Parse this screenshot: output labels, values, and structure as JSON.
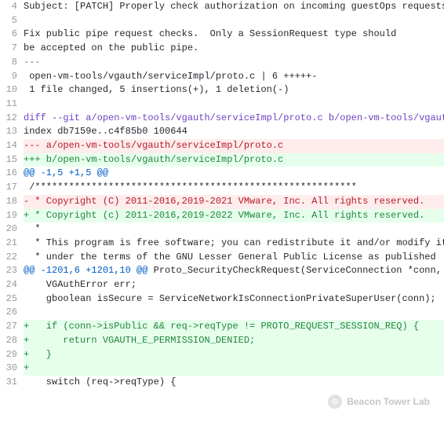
{
  "watermark": {
    "icon_label": "⊙",
    "text": "Beacon Tower Lab"
  },
  "lines": [
    {
      "n": 4,
      "bg": "",
      "tokens": [
        {
          "c": "fg-black",
          "t": "Subject: [PATCH] Properly check authorization on incoming guestOps requests"
        }
      ]
    },
    {
      "n": 5,
      "bg": "",
      "tokens": []
    },
    {
      "n": 6,
      "bg": "",
      "tokens": [
        {
          "c": "fg-black",
          "t": "Fix public pipe request checks.  Only a SessionRequest type should"
        }
      ]
    },
    {
      "n": 7,
      "bg": "",
      "tokens": [
        {
          "c": "fg-black",
          "t": "be accepted on the public pipe."
        }
      ]
    },
    {
      "n": 8,
      "bg": "",
      "tokens": [
        {
          "c": "fg-comment",
          "t": "---"
        }
      ]
    },
    {
      "n": 9,
      "bg": "",
      "tokens": [
        {
          "c": "fg-black",
          "t": " open-vm-tools/vgauth/serviceImpl/proto.c | 6 +++++-"
        }
      ]
    },
    {
      "n": 10,
      "bg": "",
      "tokens": [
        {
          "c": "fg-black",
          "t": " 1 file changed, 5 insertions(+), 1 deletion(-)"
        }
      ]
    },
    {
      "n": 11,
      "bg": "",
      "tokens": []
    },
    {
      "n": 12,
      "bg": "",
      "tokens": [
        {
          "c": "fg-diffhdr",
          "t": "diff --git a/open-vm-tools/vgauth/serviceImpl/proto.c b/open-vm-tools/vgauth/s"
        }
      ]
    },
    {
      "n": 13,
      "bg": "",
      "tokens": [
        {
          "c": "fg-black",
          "t": "index db7159e..c4f85b0 100644"
        }
      ]
    },
    {
      "n": 14,
      "bg": "bg-del",
      "tokens": [
        {
          "c": "fg-del",
          "t": "--- a/open-vm-tools/vgauth/serviceImpl/proto.c"
        }
      ]
    },
    {
      "n": 15,
      "bg": "bg-add",
      "tokens": [
        {
          "c": "fg-add",
          "t": "+++ b/open-vm-tools/vgauth/serviceImpl/proto.c"
        }
      ]
    },
    {
      "n": 16,
      "bg": "",
      "tokens": [
        {
          "c": "fg-hunk",
          "t": "@@ -1,5 +1,5 @@"
        }
      ]
    },
    {
      "n": 17,
      "bg": "",
      "tokens": [
        {
          "c": "fg-black",
          "t": " /*********************************************************"
        }
      ]
    },
    {
      "n": 18,
      "bg": "bg-del",
      "tokens": [
        {
          "c": "fg-del",
          "t": "- * Copyright (C) 2011-2016,2019-2021 VMware, Inc. All rights reserved."
        }
      ]
    },
    {
      "n": 19,
      "bg": "bg-add",
      "tokens": [
        {
          "c": "fg-add",
          "t": "+ * Copyright (c) 2011-2016,2019-2022 VMware, Inc. All rights reserved."
        }
      ]
    },
    {
      "n": 20,
      "bg": "",
      "tokens": [
        {
          "c": "fg-black",
          "t": "  *"
        }
      ]
    },
    {
      "n": 21,
      "bg": "",
      "tokens": [
        {
          "c": "fg-black",
          "t": "  * This program is free software; you can redistribute it and/or modify it"
        }
      ]
    },
    {
      "n": 22,
      "bg": "",
      "tokens": [
        {
          "c": "fg-black",
          "t": "  * under the terms of the GNU Lesser General Public License as published"
        }
      ]
    },
    {
      "n": 23,
      "bg": "",
      "tokens": [
        {
          "c": "fg-hunk",
          "t": "@@ -1201,6 +1201,10 @@"
        },
        {
          "c": "fg-black",
          "t": " Proto_SecurityCheckRequest(ServiceConnection *conn,"
        }
      ]
    },
    {
      "n": 24,
      "bg": "",
      "tokens": [
        {
          "c": "fg-black",
          "t": "    VGAuthError err;"
        }
      ]
    },
    {
      "n": 25,
      "bg": "",
      "tokens": [
        {
          "c": "fg-black",
          "t": "    gboolean isSecure = ServiceNetworkIsConnectionPrivateSuperUser(conn);"
        }
      ]
    },
    {
      "n": 26,
      "bg": "",
      "tokens": []
    },
    {
      "n": 27,
      "bg": "bg-add",
      "tokens": [
        {
          "c": "fg-add",
          "t": "+   if (conn->isPublic && req->reqType != PROTO_REQUEST_SESSION_REQ) {"
        }
      ]
    },
    {
      "n": 28,
      "bg": "bg-add",
      "tokens": [
        {
          "c": "fg-add",
          "t": "+      return VGAUTH_E_PERMISSION_DENIED;"
        }
      ]
    },
    {
      "n": 29,
      "bg": "bg-add",
      "tokens": [
        {
          "c": "fg-add",
          "t": "+   }"
        }
      ]
    },
    {
      "n": 30,
      "bg": "bg-add",
      "tokens": [
        {
          "c": "fg-add",
          "t": "+"
        }
      ]
    },
    {
      "n": 31,
      "bg": "",
      "tokens": [
        {
          "c": "fg-black",
          "t": "    switch (req->reqType) {"
        }
      ]
    }
  ]
}
